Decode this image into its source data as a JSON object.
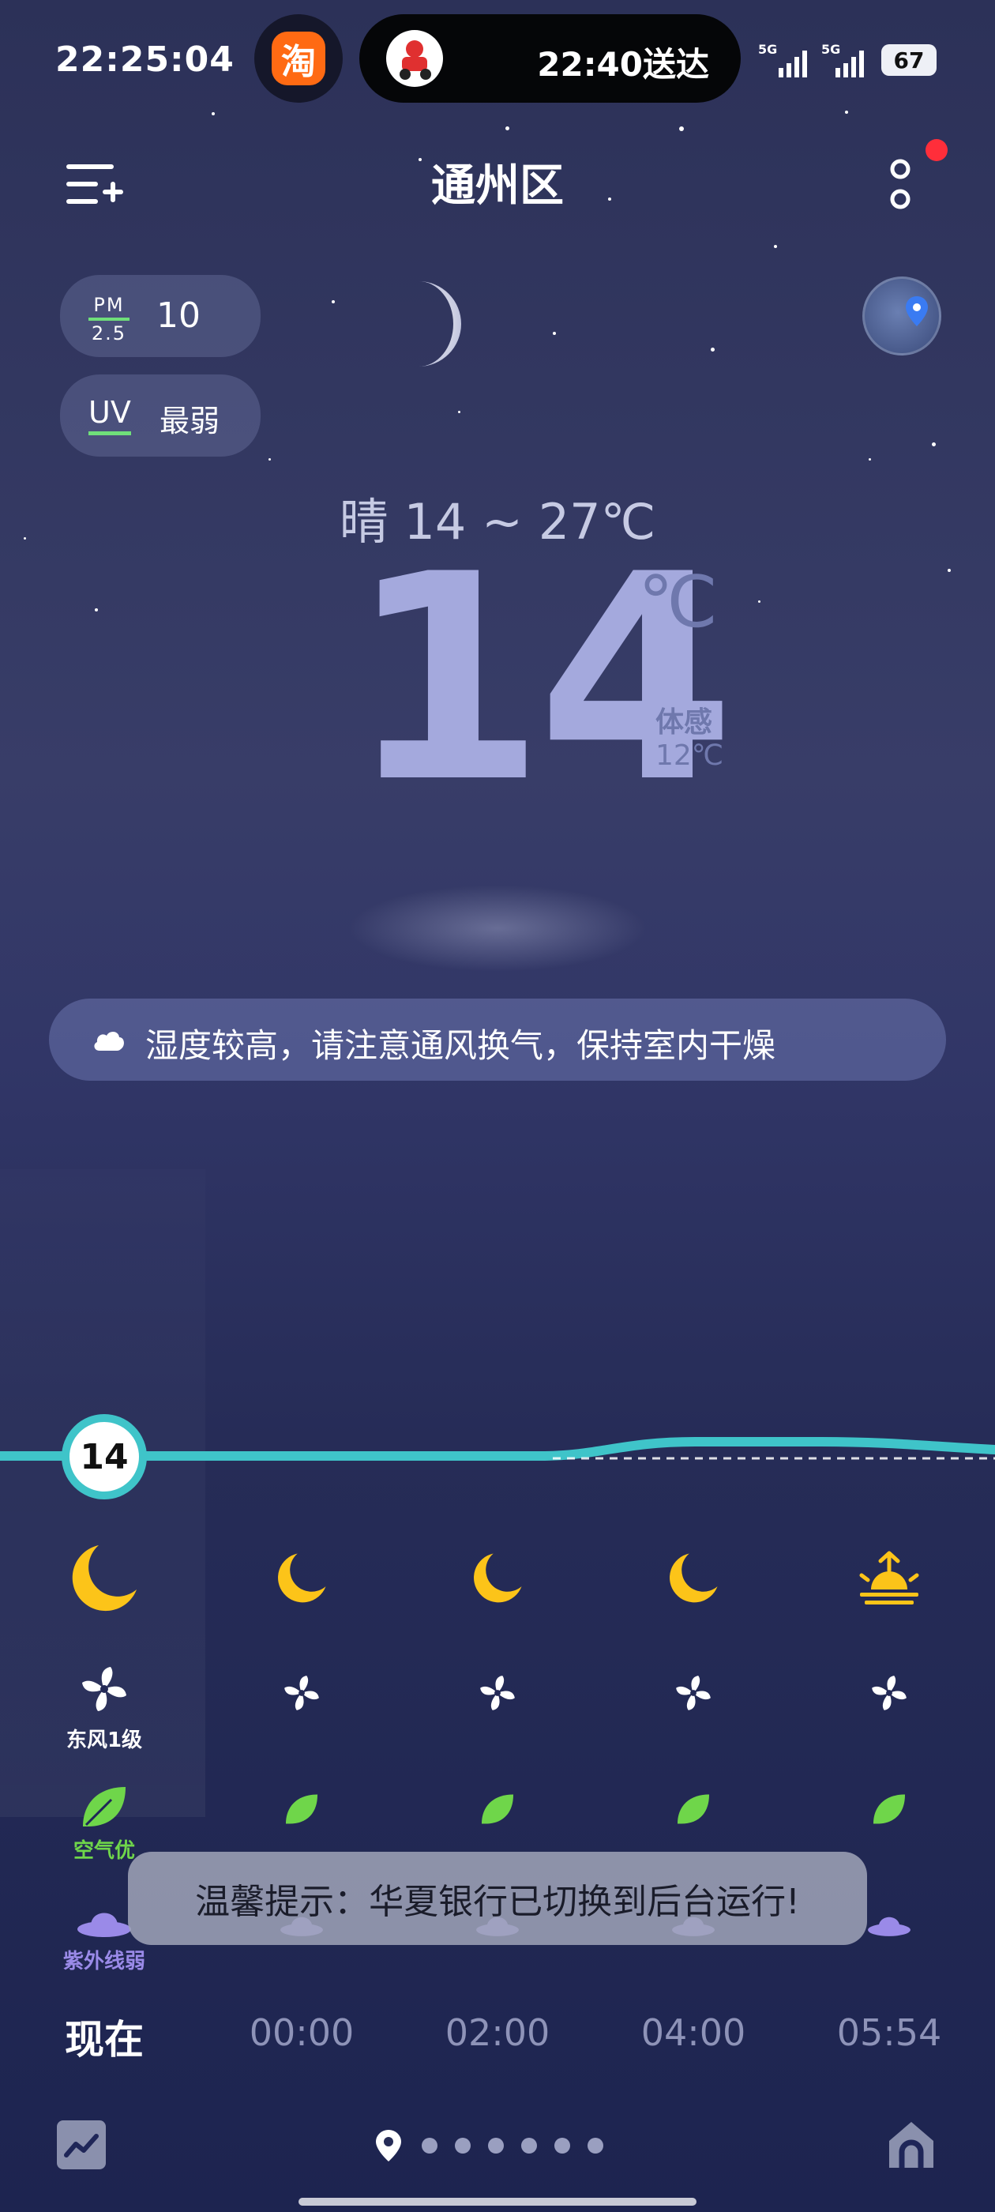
{
  "status_bar": {
    "time": "22:25:04",
    "taobao_glyph": "淘",
    "delivery_text": "22:40送达",
    "signal1": "5G",
    "signal2": "5G",
    "battery": "67"
  },
  "header": {
    "title": "通州区",
    "menu_icon": "add-city-icon",
    "more_icon": "more-vertical-icon"
  },
  "air": {
    "pm_label_top": "PM",
    "pm_label_bottom": "2.5",
    "pm_value": "10",
    "uv_label": "UV",
    "uv_value": "最弱"
  },
  "current": {
    "summary": "晴  14 ~ 27℃",
    "temp": "14",
    "unit": "℃",
    "feels_label": "体感",
    "feels_value": "12℃"
  },
  "tip": {
    "text": "湿度较高，请注意通风换气，保持室内干燥",
    "icon": "cloud-icon"
  },
  "hourly": {
    "current_temp": "14",
    "wind_label": "东风1级",
    "air_label": "空气优",
    "uv_label": "紫外线弱",
    "times": [
      "现在",
      "00:00",
      "02:00",
      "04:00",
      "05:54"
    ],
    "icons": [
      "moon-icon",
      "moon-icon",
      "moon-icon",
      "moon-icon",
      "sunrise-icon"
    ]
  },
  "toast": {
    "text": "温馨提示：华夏银行已切换到后台运行!"
  },
  "colors": {
    "accent": "#3fc4c9",
    "moon": "#fcc419",
    "leaf": "#6fd64a",
    "uv": "#9a8ae8",
    "toast_bg": "#a0a5b9"
  }
}
